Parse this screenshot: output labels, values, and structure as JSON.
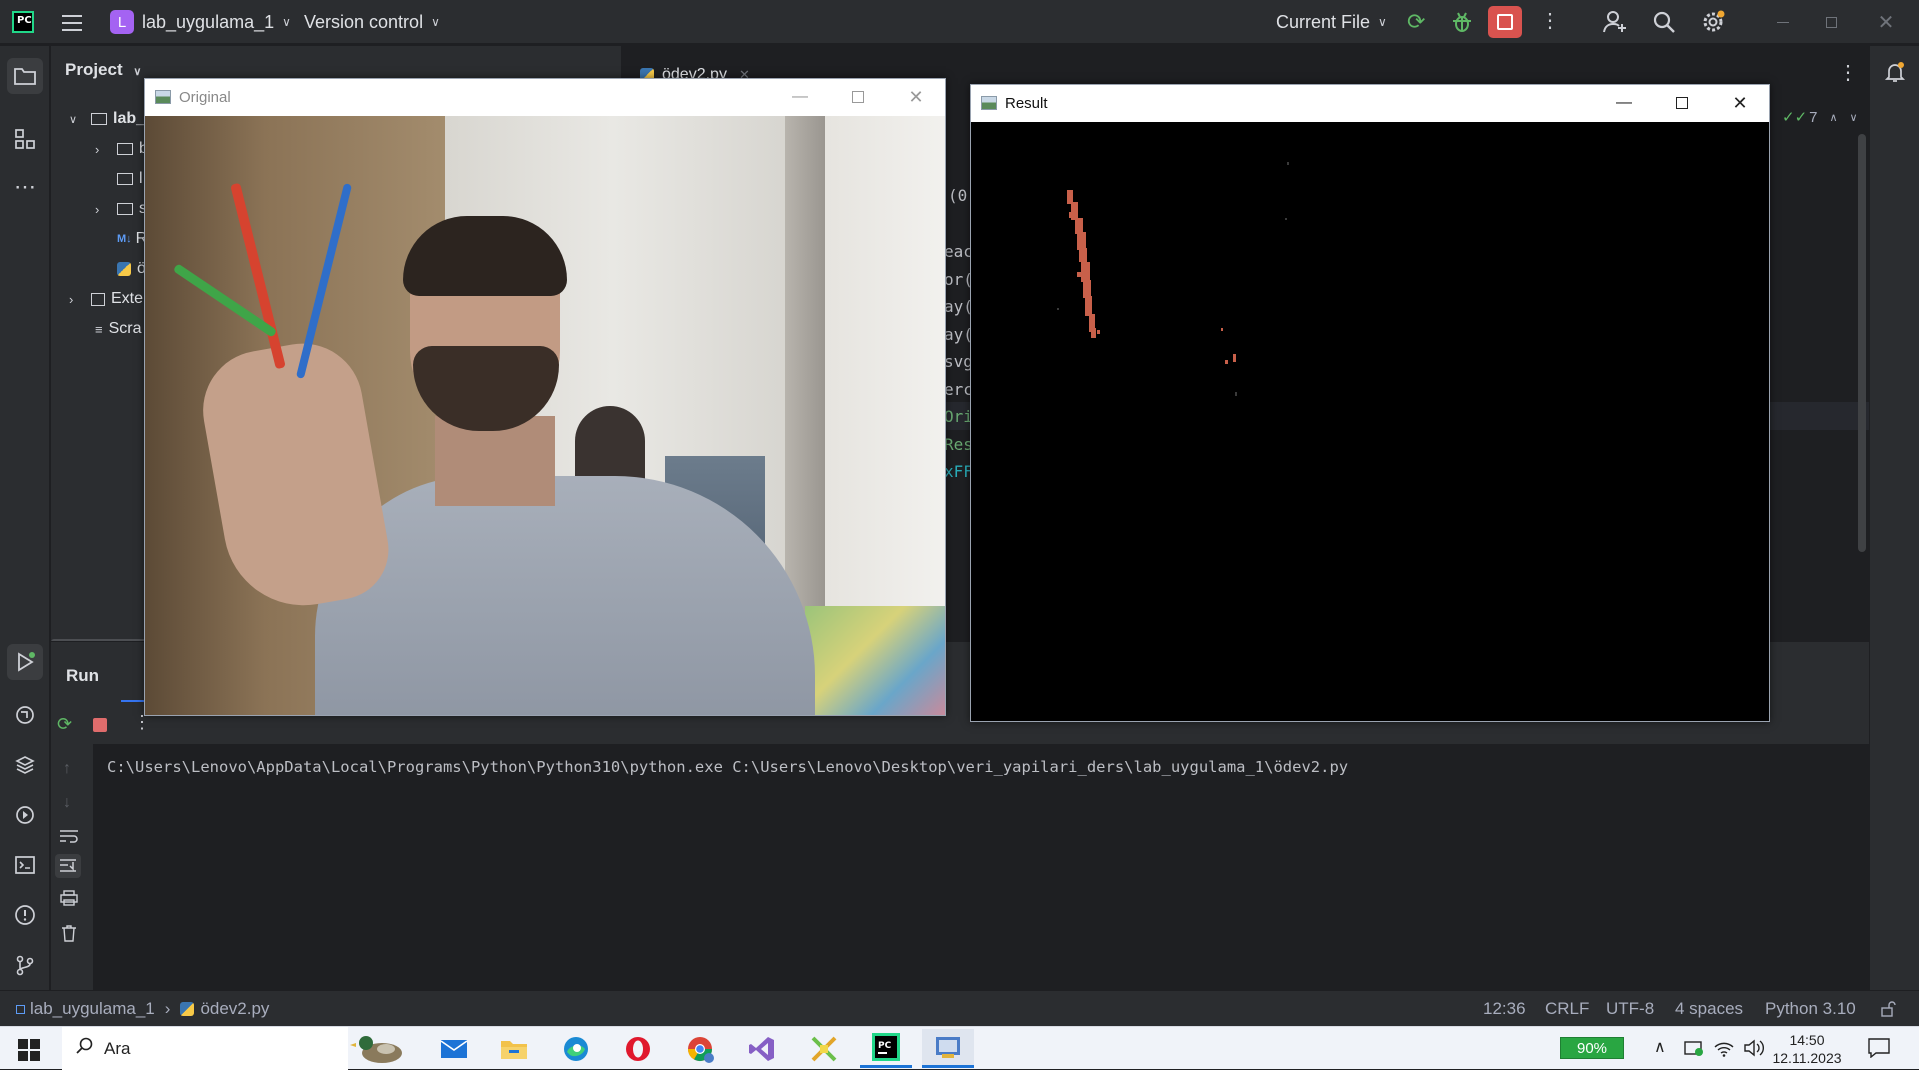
{
  "titlebar": {
    "project_badge": "L",
    "project_name": "lab_uygulama_1",
    "vcs_label": "Version control",
    "run_config": "Current File"
  },
  "project_panel": {
    "title": "Project",
    "tree": [
      {
        "label": "lab_",
        "kind": "folder-root"
      },
      {
        "label": "b",
        "kind": "folder"
      },
      {
        "label": "l",
        "kind": "folder"
      },
      {
        "label": "s",
        "kind": "folder"
      },
      {
        "label": "R",
        "kind": "markdown"
      },
      {
        "label": "ö",
        "kind": "python"
      },
      {
        "label": "Exte",
        "kind": "libraries"
      },
      {
        "label": "Scra",
        "kind": "scratches"
      }
    ]
  },
  "editor": {
    "tab_label": "ödev2.py",
    "inspection_count": "7",
    "code_fragments": [
      "(0)",
      "eac",
      "or(",
      "ay(",
      "ay(",
      "svg",
      "erc",
      "Ori",
      "Res",
      "xFF"
    ]
  },
  "run_panel": {
    "tab_label": "Run",
    "console_line": "C:\\Users\\Lenovo\\AppData\\Local\\Programs\\Python\\Python310\\python.exe C:\\Users\\Lenovo\\Desktop\\veri_yapilari_ders\\lab_uygulama_1\\ödev2.py"
  },
  "opencv_windows": {
    "original_title": "Original",
    "result_title": "Result"
  },
  "statusbar": {
    "breadcrumb_project": "lab_uygulama_1",
    "breadcrumb_file": "ödev2.py",
    "position": "12:36",
    "line_sep": "CRLF",
    "encoding": "UTF-8",
    "indent": "4 spaces",
    "interpreter": "Python 3.10"
  },
  "taskbar": {
    "search_label": "Ara",
    "battery": "90%",
    "time": "14:50",
    "date": "12.11.2023"
  },
  "colors": {
    "ide_bg": "#1e1f22",
    "panel_bg": "#2b2d30",
    "stop_button": "#d9534f",
    "run_green": "#5fb865",
    "taskbar_bg": "#f0f3f9"
  }
}
